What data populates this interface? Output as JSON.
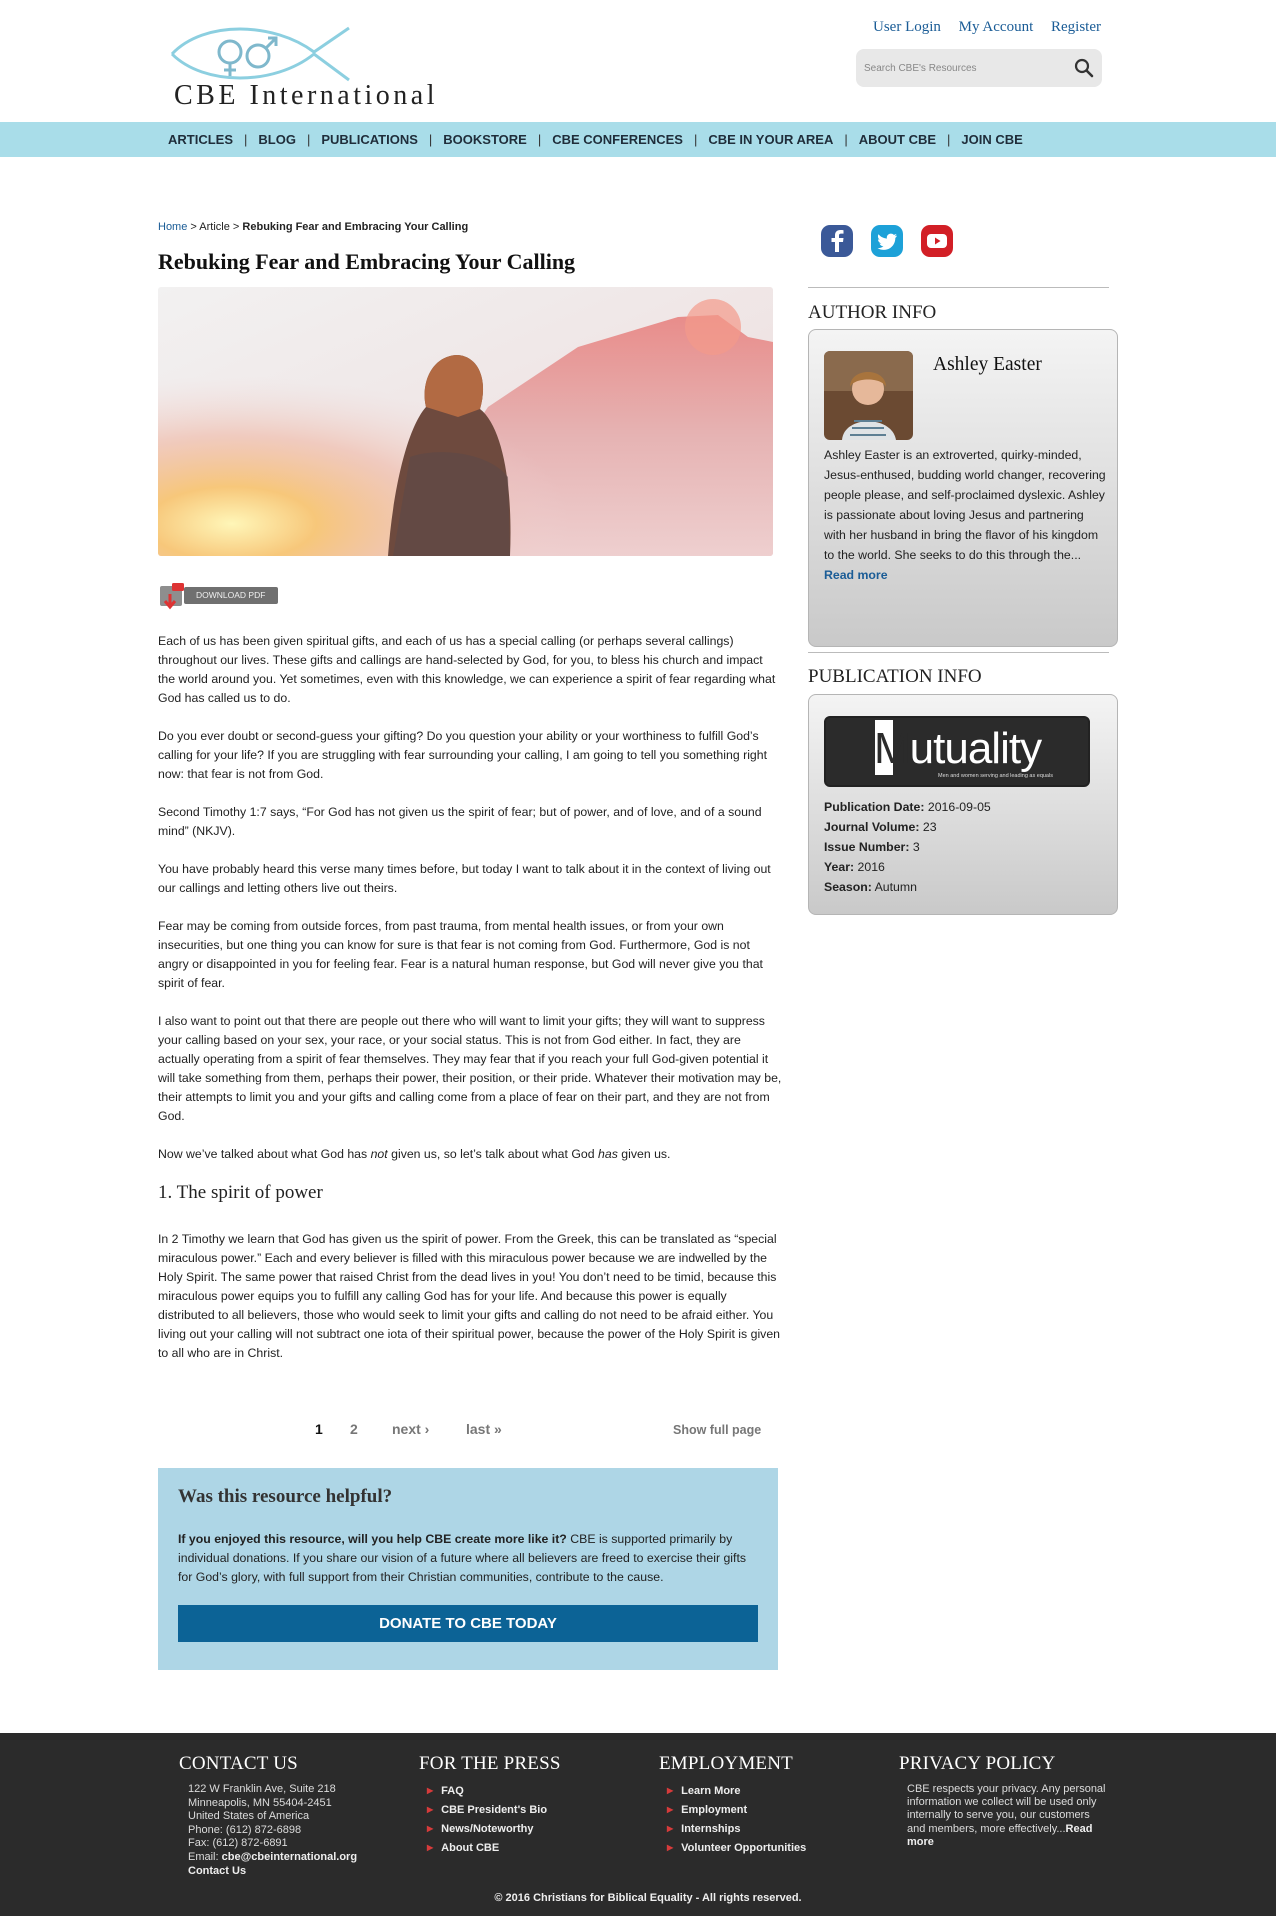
{
  "header": {
    "logo_text": "CBE International",
    "top_links": [
      "User Login",
      "My Account",
      "Register"
    ],
    "search_placeholder": "Search CBE's Resources"
  },
  "nav": [
    "ARTICLES",
    "BLOG",
    "PUBLICATIONS",
    "BOOKSTORE",
    "CBE CONFERENCES",
    "CBE IN YOUR AREA",
    "ABOUT CBE",
    "JOIN CBE"
  ],
  "breadcrumb": {
    "home": "Home",
    "sep": ">",
    "section": "Article",
    "current": "Rebuking Fear and Embracing Your Calling"
  },
  "page_title": "Rebuking Fear and Embracing Your Calling",
  "download_label": "DOWNLOAD PDF",
  "article": {
    "p1": "Each of us has been given spiritual gifts, and each of us has a special calling (or perhaps several callings) throughout our lives. These gifts and callings are hand-selected by God, for you, to bless his church and impact the world around you. Yet sometimes, even with this knowledge, we can experience a spirit of fear regarding what God has called us to do.",
    "p2": "Do you ever doubt or second-guess your gifting? Do you question your ability or your worthiness to fulfill God’s calling for your life? If you are struggling with fear surrounding your calling, I am going to tell you something right now: that fear is not from God.",
    "p3": "Second Timothy 1:7 says, “For God has not given us the spirit of fear; but of power, and of love, and of a sound mind” (NKJV).",
    "p4": "You have probably heard this verse many times before, but today I want to talk about it in the context of living out our callings and letting others live out theirs.",
    "p5": "Fear may be coming from outside forces, from past trauma, from mental health issues, or from your own insecurities, but one thing you can know for sure is that fear is not coming from God. Furthermore, God is not angry or disappointed in you for feeling fear. Fear is a natural human response, but God will never give you that spirit of fear.",
    "p6": "I also want to point out that there are people out there who will want to limit your gifts; they will want to suppress your calling based on your sex, your race, or your social status. This is not from God either. In fact, they are actually operating from a spirit of fear themselves. They may fear that if you reach your full God-given potential it will take something from them, perhaps their power, their position, or their pride. Whatever their motivation may be, their attempts to limit you and your gifts and calling come from a place of fear on their part, and they are not from God.",
    "p7_a": "Now we’ve talked about what God has ",
    "p7_not": "not",
    "p7_b": " given us, so let’s talk about what God ",
    "p7_has": "has",
    "p7_c": " given us.",
    "h2": "1. The spirit of power",
    "p8": "In 2 Timothy we learn that God has given us the spirit of power. From the Greek, this can be translated as “special miraculous power.” Each and every believer is filled with this miraculous power because we are indwelled by the Holy Spirit. The same power that raised Christ from the dead lives in you! You don’t need to be timid, because this miraculous power equips you to fulfill any calling God has for your life. And because this power is equally distributed to all believers, those who would seek to limit your gifts and calling do not need to be afraid either. You living out your calling will not subtract one iota of their spiritual power, because the power of the Holy Spirit is given to all who are in Christ."
  },
  "pager": {
    "page1": "1",
    "page2": "2",
    "next": "next ›",
    "last": "last »",
    "show_full": "Show full page"
  },
  "helpful": {
    "title": "Was this resource helpful?",
    "lead": "If you enjoyed this resource, will you help CBE create more like it?",
    "body": " CBE is supported primarily by individual donations. If you share our vision of a future where all believers are freed to exercise their gifts for God’s glory, with full support from their Christian communities, contribute to the cause.",
    "button": "DONATE TO CBE TODAY"
  },
  "sidebar": {
    "social_icons": [
      "facebook-icon",
      "twitter-icon",
      "youtube-icon"
    ],
    "author_heading": "AUTHOR INFO",
    "author_name": "Ashley Easter",
    "author_bio": "Ashley Easter is an extroverted, quirky-minded, Jesus-enthused, budding world changer, recovering people please, and self-proclaimed dyslexic. Ashley is passionate about loving Jesus and partnering with her husband in bring the flavor of his kingdom to the world. She seeks to do this through the...",
    "author_more": "Read more",
    "publication_heading": "PUBLICATION INFO",
    "publication_logo": "Mutuality",
    "publication_logo_m": "M",
    "publication_logo_rest": "utuality",
    "publication_logo_sub": "Men and women serving and leading as equals",
    "publication": [
      {
        "label": "Publication Date:",
        "value": "2016-09-05"
      },
      {
        "label": "Journal Volume:",
        "value": "23"
      },
      {
        "label": "Issue Number:",
        "value": "3"
      },
      {
        "label": "Year:",
        "value": "2016"
      },
      {
        "label": "Season:",
        "value": "Autumn"
      }
    ]
  },
  "footer": {
    "contact_heading": "CONTACT US",
    "address1": "122 W Franklin Ave, Suite 218",
    "address2": "Minneapolis, MN  55404-2451",
    "address3": "United States of America",
    "phone": "Phone: (612) 872-6898",
    "fax": "Fax: (612) 872-6891",
    "email_label": "Email: ",
    "email": "cbe@cbeinternational.org",
    "contact_link": "Contact Us",
    "press_heading": "FOR THE PRESS",
    "press_links": [
      "FAQ",
      "CBE President's Bio",
      "News/Noteworthy",
      "About CBE"
    ],
    "employment_heading": "EMPLOYMENT",
    "employment_links": [
      "Learn More",
      "Employment",
      "Internships",
      "Volunteer Opportunities"
    ],
    "privacy_heading": "PRIVACY POLICY",
    "privacy_text": "CBE respects your privacy. Any personal information we collect will be used only internally to serve you, our customers and members, more effectively...",
    "privacy_more": "Read more",
    "copyright": "© 2016 Christians for Biblical Equality - All rights reserved."
  },
  "colors": {
    "nav_bg": "#a9dde9",
    "link": "#1a5c96",
    "donate": "#0c6396",
    "footer_bg": "#2b2b2b",
    "helpful_bg": "#aed6e6"
  }
}
